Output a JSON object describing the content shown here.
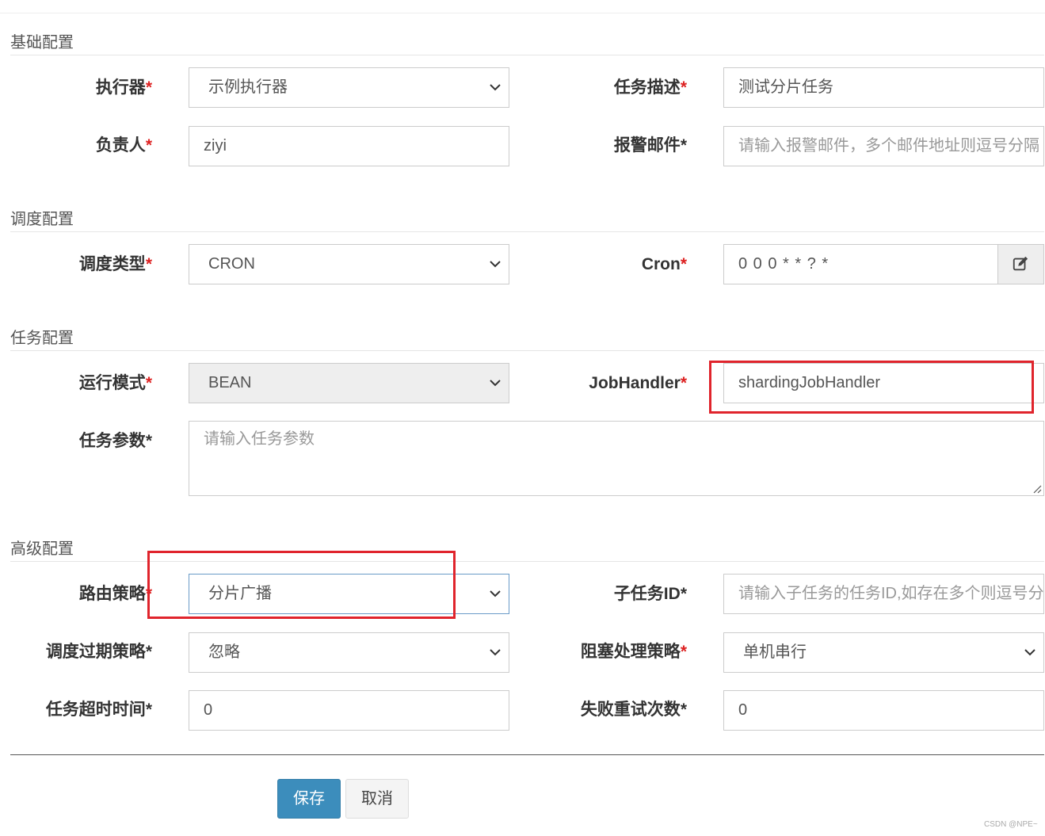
{
  "sections": {
    "basic": "基础配置",
    "schedule": "调度配置",
    "task": "任务配置",
    "advanced": "高级配置"
  },
  "fields": {
    "executor": {
      "label": "执行器",
      "required_mark": "*",
      "value": "示例执行器"
    },
    "job_desc": {
      "label": "任务描述",
      "required_mark": "*",
      "value": "测试分片任务"
    },
    "author": {
      "label": "负责人",
      "required_mark": "*",
      "value": "ziyi"
    },
    "alarm_email": {
      "label": "报警邮件",
      "required_mark": "*",
      "placeholder": "请输入报警邮件，多个邮件地址则逗号分隔"
    },
    "schedule_type": {
      "label": "调度类型",
      "required_mark": "*",
      "value": "CRON"
    },
    "cron": {
      "label": "Cron",
      "required_mark": "*",
      "value": "0 0 0 * * ? *"
    },
    "glue_type": {
      "label": "运行模式",
      "required_mark": "*",
      "value": "BEAN"
    },
    "job_handler": {
      "label": "JobHandler",
      "required_mark": "*",
      "value": "shardingJobHandler"
    },
    "job_param": {
      "label": "任务参数",
      "required_mark": "*",
      "placeholder": "请输入任务参数"
    },
    "route_strategy": {
      "label": "路由策略",
      "required_mark": "*",
      "value": "分片广播"
    },
    "child_job_id": {
      "label": "子任务ID",
      "required_mark": "*",
      "placeholder": "请输入子任务的任务ID,如存在多个则逗号分隔"
    },
    "misfire_strategy": {
      "label": "调度过期策略",
      "required_mark": "*",
      "value": "忽略"
    },
    "block_strategy": {
      "label": "阻塞处理策略",
      "required_mark": "*",
      "value": "单机串行"
    },
    "timeout": {
      "label": "任务超时时间",
      "required_mark": "*",
      "value": "0"
    },
    "fail_retry": {
      "label": "失败重试次数",
      "required_mark": "*",
      "value": "0"
    }
  },
  "buttons": {
    "save": "保存",
    "cancel": "取消"
  },
  "icons": {
    "cron_edit": "edit-icon",
    "select_arrow": "chevron-down-icon"
  },
  "colors": {
    "required": "#dd2222",
    "primary_button": "#3c8dbc",
    "highlight_box": "#e0242c"
  },
  "watermark": "CSDN @NPE~"
}
